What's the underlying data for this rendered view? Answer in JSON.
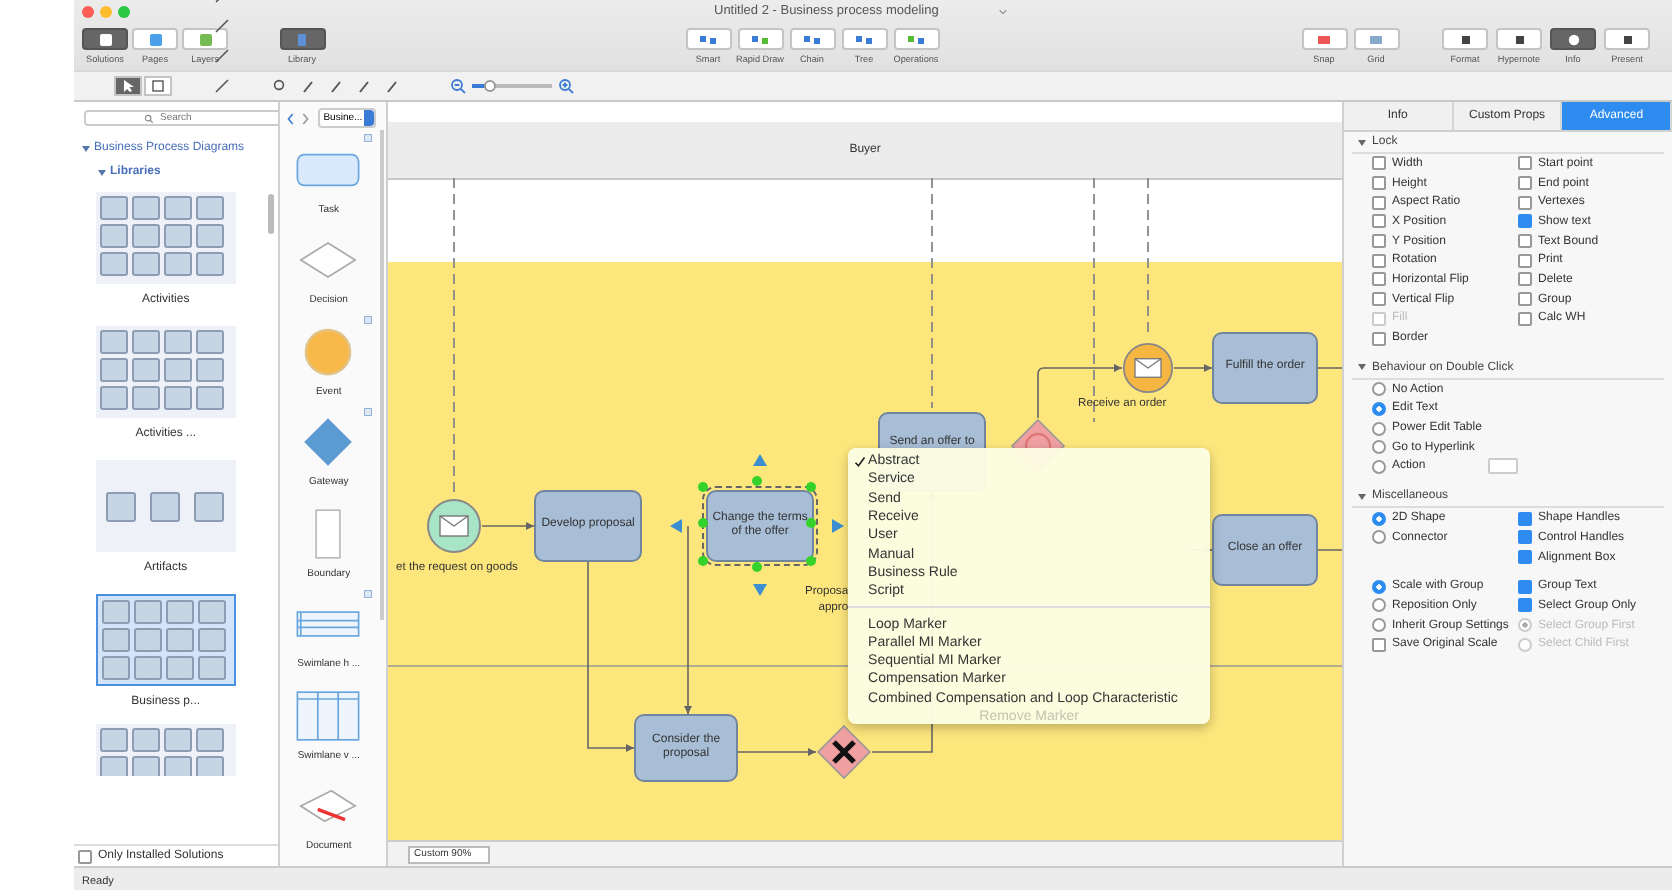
{
  "window": {
    "title": "Untitled 2 - Business process modeling"
  },
  "toolbar": {
    "segments": [
      {
        "label": "Solutions",
        "selected": true
      },
      {
        "label": "Pages",
        "selected": false
      },
      {
        "label": "Layers",
        "selected": false
      }
    ],
    "library": {
      "label": "Library",
      "selected": true
    },
    "center": [
      {
        "label": "Smart"
      },
      {
        "label": "Rapid Draw"
      },
      {
        "label": "Chain"
      },
      {
        "label": "Tree"
      },
      {
        "label": "Operations"
      }
    ],
    "snap": [
      {
        "label": "Snap"
      },
      {
        "label": "Grid"
      }
    ],
    "right": [
      {
        "label": "Format",
        "selected": false
      },
      {
        "label": "Hypernote",
        "selected": false
      },
      {
        "label": "Info",
        "selected": true
      },
      {
        "label": "Present",
        "selected": false
      }
    ]
  },
  "tools": [
    {
      "selected": true
    },
    {
      "selected": false
    }
  ],
  "zoom": {
    "level": 0.22
  },
  "library_panel": {
    "search": {
      "placeholder": "Search"
    },
    "tree": {
      "label": "Business Process Diagrams",
      "expanded": true,
      "children": [
        {
          "label": "Libraries",
          "expanded": true
        }
      ]
    },
    "libraries": [
      {
        "label": "Activities",
        "selected": false
      },
      {
        "label": "Activities ...",
        "selected": false
      },
      {
        "label": "Artifacts",
        "selected": false
      },
      {
        "label": "Business p...",
        "selected": true
      }
    ],
    "only_installed": {
      "label": "Only Installed Solutions",
      "checked": false
    }
  },
  "shapes_panel": {
    "dropdown": "Busine...",
    "shapes": [
      {
        "kind": "task",
        "label": "Task",
        "badge": true
      },
      {
        "kind": "decision",
        "label": "Decision",
        "badge": false
      },
      {
        "kind": "event",
        "label": "Event",
        "badge": true
      },
      {
        "kind": "gateway",
        "label": "Gateway",
        "badge": true
      },
      {
        "kind": "boundary",
        "label": "Boundary",
        "badge": false
      },
      {
        "kind": "swimlane_h",
        "label": "Swimlane h ...",
        "badge": true
      },
      {
        "kind": "swimlane_v",
        "label": "Swimlane v ...",
        "badge": false
      },
      {
        "kind": "document",
        "label": "Document",
        "badge": false
      }
    ]
  },
  "canvas": {
    "pool": "Buyer",
    "nodes": [
      {
        "kind": "event",
        "caption": "et the request on goods",
        "color": "#a8e4c6",
        "selected": false
      },
      {
        "kind": "task",
        "label": "Develop proposal",
        "selected": false
      },
      {
        "kind": "task",
        "label": "Change the terms of the offer",
        "selected": true
      },
      {
        "kind": "task",
        "label": "Consider the proposal",
        "selected": false
      },
      {
        "kind": "gateway",
        "exclusive": true,
        "selected": false
      },
      {
        "kind": "task",
        "label": "Send an offer to",
        "selected": false
      },
      {
        "kind": "gateway",
        "exclusive": false,
        "selected": false
      },
      {
        "kind": "event",
        "caption": "Receive an order",
        "color": "#f5b642",
        "selected": false
      },
      {
        "kind": "task",
        "label": "Fulfill the order",
        "selected": false
      },
      {
        "kind": "task",
        "label": "Close an offer",
        "selected": false
      }
    ],
    "labels": [
      {
        "lines": [
          "Proposa",
          "appro"
        ]
      }
    ],
    "menu": {
      "groups": [
        {
          "items": [
            {
              "label": "Abstract",
              "checked": true,
              "disabled": false
            },
            {
              "label": "Service",
              "checked": false,
              "disabled": false
            },
            {
              "label": "Send",
              "checked": false,
              "disabled": false
            },
            {
              "label": "Receive",
              "checked": false,
              "disabled": false
            },
            {
              "label": "User",
              "checked": false,
              "disabled": false
            },
            {
              "label": "Manual",
              "checked": false,
              "disabled": false
            },
            {
              "label": "Business Rule",
              "checked": false,
              "disabled": false
            },
            {
              "label": "Script",
              "checked": false,
              "disabled": false
            }
          ]
        },
        {
          "items": [
            {
              "label": "Loop Marker",
              "checked": false,
              "disabled": false
            },
            {
              "label": "Parallel MI Marker",
              "checked": false,
              "disabled": false
            },
            {
              "label": "Sequential MI Marker",
              "checked": false,
              "disabled": false
            },
            {
              "label": "Compensation Marker",
              "checked": false,
              "disabled": false
            },
            {
              "label": "Combined Compensation and Loop Characteristic",
              "checked": false,
              "disabled": false
            },
            {
              "label": "Remove Marker",
              "checked": false,
              "disabled": true
            }
          ]
        }
      ]
    },
    "zoom_select": "Custom 90%"
  },
  "inspector": {
    "tabs": [
      {
        "label": "Info",
        "selected": false
      },
      {
        "label": "Custom Props",
        "selected": false
      },
      {
        "label": "Advanced",
        "selected": true
      }
    ],
    "sections": [
      {
        "title": "Lock",
        "expanded": true,
        "groups": [
          {
            "left": [
              {
                "kind": "checkbox",
                "label": "Width",
                "on": false,
                "disabled": false
              },
              {
                "kind": "checkbox",
                "label": "Height",
                "on": false,
                "disabled": false
              },
              {
                "kind": "checkbox",
                "label": "Aspect Ratio",
                "on": false,
                "disabled": false
              },
              {
                "kind": "checkbox",
                "label": "X Position",
                "on": false,
                "disabled": false
              },
              {
                "kind": "checkbox",
                "label": "Y Position",
                "on": false,
                "disabled": false
              },
              {
                "kind": "checkbox",
                "label": "Rotation",
                "on": false,
                "disabled": false
              },
              {
                "kind": "checkbox",
                "label": "Horizontal Flip",
                "on": false,
                "disabled": false
              },
              {
                "kind": "checkbox",
                "label": "Vertical Flip",
                "on": false,
                "disabled": false
              },
              {
                "kind": "checkbox",
                "label": "Fill",
                "on": false,
                "disabled": true
              },
              {
                "kind": "checkbox",
                "label": "Border",
                "on": false,
                "disabled": false
              }
            ],
            "right": [
              {
                "kind": "checkbox",
                "label": "Start point",
                "on": false,
                "disabled": false
              },
              {
                "kind": "checkbox",
                "label": "End point",
                "on": false,
                "disabled": false
              },
              {
                "kind": "checkbox",
                "label": "Vertexes",
                "on": false,
                "disabled": false
              },
              {
                "kind": "checkbox",
                "label": "Show text",
                "on": true,
                "disabled": false
              },
              {
                "kind": "checkbox",
                "label": "Text Bound",
                "on": false,
                "disabled": false
              },
              {
                "kind": "checkbox",
                "label": "Print",
                "on": false,
                "disabled": false
              },
              {
                "kind": "checkbox",
                "label": "Delete",
                "on": false,
                "disabled": false
              },
              {
                "kind": "checkbox",
                "label": "Group",
                "on": false,
                "disabled": false
              },
              {
                "kind": "checkbox",
                "label": "Calc WH",
                "on": false,
                "disabled": false
              }
            ]
          }
        ]
      },
      {
        "title": "Behaviour on Double Click",
        "expanded": true,
        "groups": [
          {
            "left": [
              {
                "kind": "radio",
                "label": "No Action",
                "on": false,
                "disabled": false
              },
              {
                "kind": "radio",
                "label": "Edit Text",
                "on": true,
                "disabled": false
              },
              {
                "kind": "radio",
                "label": "Power Edit Table",
                "on": false,
                "disabled": false
              },
              {
                "kind": "radio",
                "label": "Go to Hyperlink",
                "on": false,
                "disabled": false
              },
              {
                "kind": "radio_select",
                "label": "Action",
                "on": false,
                "disabled": false
              }
            ]
          }
        ]
      },
      {
        "title": "Miscellaneous",
        "expanded": true,
        "groups": [
          {
            "left": [
              {
                "kind": "radio",
                "label": "2D Shape",
                "on": true,
                "disabled": false
              },
              {
                "kind": "radio",
                "label": "Connector",
                "on": false,
                "disabled": false
              }
            ],
            "right": [
              {
                "kind": "checkbox",
                "label": "Shape Handles",
                "on": true,
                "disabled": false
              },
              {
                "kind": "checkbox",
                "label": "Control Handles",
                "on": true,
                "disabled": false
              },
              {
                "kind": "checkbox",
                "label": "Alignment Box",
                "on": true,
                "disabled": false
              }
            ]
          },
          {
            "left": [
              {
                "kind": "radio",
                "label": "Scale with Group",
                "on": true,
                "disabled": false
              },
              {
                "kind": "radio",
                "label": "Reposition Only",
                "on": false,
                "disabled": false
              },
              {
                "kind": "radio",
                "label": "Inherit Group Settings",
                "on": false,
                "disabled": false
              },
              {
                "kind": "checkbox",
                "label": "Save Original Scale",
                "on": false,
                "disabled": false
              }
            ],
            "right": [
              {
                "kind": "checkbox",
                "label": "Group Text",
                "on": true,
                "disabled": false
              },
              {
                "kind": "checkbox",
                "label": "Select Group Only",
                "on": true,
                "disabled": false
              },
              {
                "kind": "radio",
                "label": "Select Group First",
                "on": true,
                "disabled": true
              },
              {
                "kind": "radio",
                "label": "Select Child First",
                "on": false,
                "disabled": true
              }
            ]
          }
        ]
      }
    ]
  },
  "status_bar": "Ready"
}
